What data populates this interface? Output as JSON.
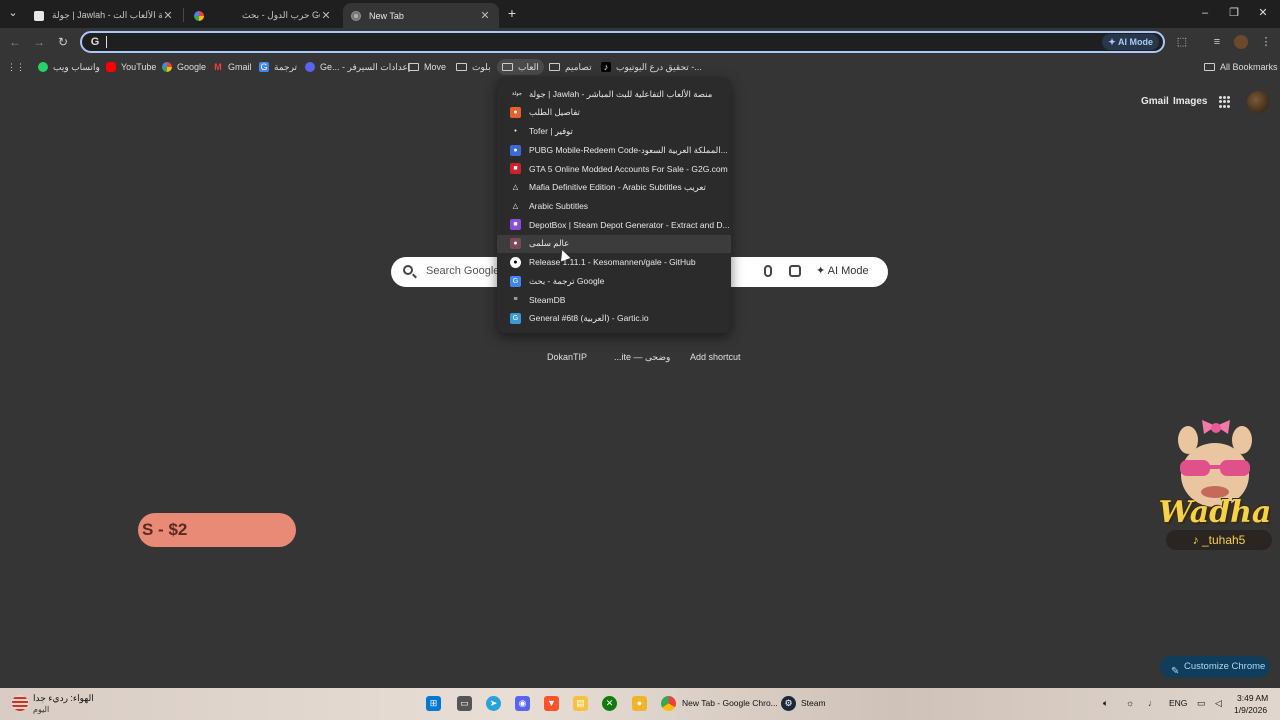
{
  "tabs": [
    {
      "title": "جولة | Jawlah - منصة الألعاب الت...",
      "icon": "jawlah-icon",
      "close": "✕"
    },
    {
      "title": "حرب الدول - بحث Google",
      "icon": "google-icon",
      "close": "✕"
    },
    {
      "title": "New Tab",
      "icon": "chrome-icon",
      "close": "✕",
      "active": true
    }
  ],
  "tabstrip": {
    "new_tab": "+",
    "minimize": "–",
    "restore": "❐",
    "close": "✕",
    "tab_search": "⌄"
  },
  "toolbar": {
    "back": "←",
    "forward": "→",
    "reload": "↻",
    "omnibox_g": "G",
    "ai_mode_label": "AI Mode",
    "extensions": "⬚",
    "media": "≡",
    "menu": "⋮"
  },
  "bookmarks": {
    "apps": "⋮⋮",
    "items": [
      {
        "label": "واتساب ويب",
        "icon": "whatsapp-icon",
        "color": "#25d366"
      },
      {
        "label": "YouTube",
        "icon": "youtube-icon",
        "color": "#ff0000"
      },
      {
        "label": "Google",
        "icon": "google-icon",
        "color": "#4285f4"
      },
      {
        "label": "Gmail",
        "icon": "gmail-icon",
        "color": "#ea4335"
      },
      {
        "label": "ترجمة",
        "icon": "translate-icon",
        "color": "#4285f4"
      },
      {
        "label": "Ge... - إعدادات السيرفر",
        "icon": "discord-icon",
        "color": "#5865f2"
      },
      {
        "label": "Move",
        "icon": "folder-icon"
      },
      {
        "label": "بلوت",
        "icon": "folder-icon"
      },
      {
        "label": "العاب",
        "icon": "folder-icon",
        "active": true
      },
      {
        "label": "تصاميم",
        "icon": "folder-icon"
      },
      {
        "label": "تحقيق درع اليوتيوب -...",
        "icon": "tiktok-icon",
        "color": "#000"
      }
    ],
    "all_bookmarks": "All Bookmarks"
  },
  "ntp": {
    "gmail": "Gmail",
    "images": "Images",
    "search_placeholder": "Search Google",
    "ai_mode": "AI Mode",
    "shortcuts": [
      "DokanTIP",
      "...ite — وضحى",
      "Add shortcut"
    ]
  },
  "dropdown": [
    {
      "label": "جولة | Jawlah - منصة الألعاب التفاعلية للبث المباشر",
      "icon": "jawlah-icon",
      "color": "#2b2b2b",
      "glyph": "جولة"
    },
    {
      "label": "تفاصيل الطلب",
      "icon": "order-icon",
      "color": "#e8612c",
      "glyph": "●"
    },
    {
      "label": "Tofer | توفير",
      "icon": "tofer-icon",
      "color": "#2b2b2b",
      "glyph": "•"
    },
    {
      "label": "PUBG Mobile-Redeem Code-المملكة العربية السعود...",
      "icon": "pubg-icon",
      "color": "#3a6ad8",
      "glyph": "●"
    },
    {
      "label": "GTA 5 Online Modded Accounts For Sale - G2G.com",
      "icon": "g2g-icon",
      "color": "#d0202a",
      "glyph": "■"
    },
    {
      "label": "Mafia Definitive Edition - Arabic Subtitles تعريب",
      "icon": "subtitles-icon",
      "color": "#2b2b2b",
      "glyph": "△"
    },
    {
      "label": "Arabic Subtitles",
      "icon": "subtitles-icon",
      "color": "#2b2b2b",
      "glyph": "△"
    },
    {
      "label": "DepotBox | Steam Depot Generator - Extract and D...",
      "icon": "depotbox-icon",
      "color": "#8a4fd8",
      "glyph": "■"
    },
    {
      "label": "عالم سلمى",
      "icon": "salma-icon",
      "color": "#7a4a5a",
      "glyph": "●",
      "hover": true
    },
    {
      "label": "Release 1.11.1 - Kesomannen/gale - GitHub",
      "icon": "github-icon",
      "color": "#ffffff",
      "glyph": "●"
    },
    {
      "label": "ترجمة - بحث Google",
      "icon": "google-icon",
      "color": "#4285f4",
      "glyph": "G"
    },
    {
      "label": "SteamDB",
      "icon": "steamdb-icon",
      "color": "#2b2b2b",
      "glyph": "≡"
    },
    {
      "label": "General #6t8 (العربية) - Gartic.io",
      "icon": "gartic-icon",
      "color": "#3a9ad8",
      "glyph": "G"
    }
  ],
  "overlay": {
    "promo_text": "S - $2",
    "logo_name": "Wadha",
    "logo_handle": "_tuhah5"
  },
  "customize": "Customize Chrome",
  "taskbar": {
    "weather_title": "الهواء: رديء جدا",
    "weather_sub": "اليوم",
    "chrome_label": "New Tab - Google Chro...",
    "steam_label": "Steam",
    "lang": "ENG",
    "time": "3:49 AM",
    "date": "1/9/2026"
  }
}
